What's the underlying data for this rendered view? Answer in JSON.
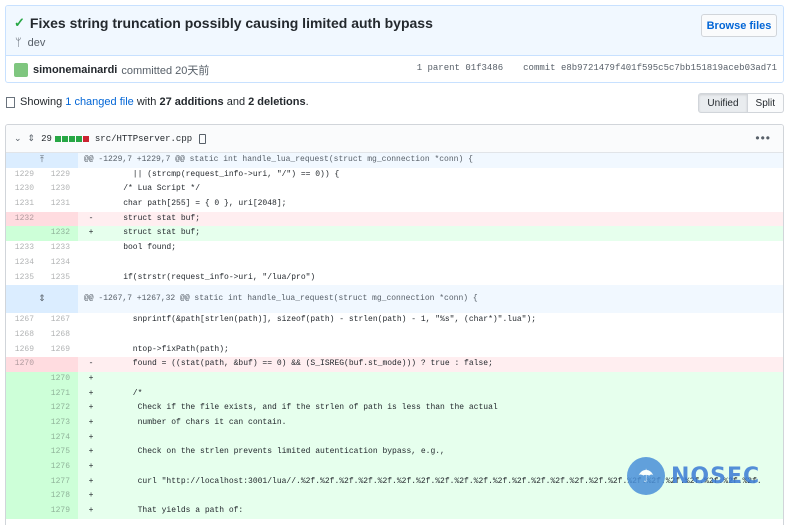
{
  "commit": {
    "title": "Fixes string truncation possibly causing limited auth bypass",
    "branch": "dev",
    "browse_label": "Browse files",
    "author": "simonemainardi",
    "committed_text": "committed 20天前",
    "parent_label": "1 parent",
    "parent_hash": "01f3486",
    "commit_label": "commit",
    "commit_hash": "e8b9721479f401f595c5c7bb151819aceb03ad71"
  },
  "summary": {
    "prefix": "Showing",
    "changed_files": "1 changed file",
    "with": "with",
    "additions": "27 additions",
    "and": "and",
    "deletions": "2 deletions",
    "suffix": "."
  },
  "view": {
    "unified": "Unified",
    "split": "Split"
  },
  "file": {
    "change_count": "29",
    "path": "src/HTTPserver.cpp",
    "more": "•••"
  },
  "diff": {
    "hunk1": "@@ -1229,7 +1229,7 @@ static int handle_lua_request(struct mg_connection *conn) {",
    "hunk2": "@@ -1267,7 +1267,32 @@ static int handle_lua_request(struct mg_connection *conn) {",
    "lines": [
      {
        "type": "ctx",
        "old": "1229",
        "new": "1229",
        "sign": "",
        "code": "      || (strcmp(request_info->uri, \"/\") == 0)) {"
      },
      {
        "type": "ctx",
        "old": "1230",
        "new": "1230",
        "sign": "",
        "code": "    /* Lua Script */"
      },
      {
        "type": "ctx",
        "old": "1231",
        "new": "1231",
        "sign": "",
        "code": "    char path[255] = { 0 }, uri[2048];"
      },
      {
        "type": "del",
        "old": "1232",
        "new": "",
        "sign": "-",
        "code": "    struct stat buf;"
      },
      {
        "type": "add",
        "old": "",
        "new": "1232",
        "sign": "+",
        "code": "    struct stat buf;"
      },
      {
        "type": "ctx",
        "old": "1233",
        "new": "1233",
        "sign": "",
        "code": "    bool found;"
      },
      {
        "type": "ctx",
        "old": "1234",
        "new": "1234",
        "sign": "",
        "code": ""
      },
      {
        "type": "ctx",
        "old": "1235",
        "new": "1235",
        "sign": "",
        "code": "    if(strstr(request_info->uri, \"/lua/pro\")"
      },
      {
        "type": "ctx",
        "old": "1267",
        "new": "1267",
        "sign": "",
        "code": "      snprintf(&path[strlen(path)], sizeof(path) - strlen(path) - 1, \"%s\", (char*)\".lua\");"
      },
      {
        "type": "ctx",
        "old": "1268",
        "new": "1268",
        "sign": "",
        "code": ""
      },
      {
        "type": "ctx",
        "old": "1269",
        "new": "1269",
        "sign": "",
        "code": "      ntop->fixPath(path);"
      },
      {
        "type": "del",
        "old": "1270",
        "new": "",
        "sign": "-",
        "code": "      found = ((stat(path, &buf) == 0) && (S_ISREG(buf.st_mode))) ? true : false;"
      },
      {
        "type": "add",
        "old": "",
        "new": "1270",
        "sign": "+",
        "code": ""
      },
      {
        "type": "add",
        "old": "",
        "new": "1271",
        "sign": "+",
        "code": "      /*"
      },
      {
        "type": "add",
        "old": "",
        "new": "1272",
        "sign": "+",
        "code": "       Check if the file exists, and if the strlen of path is less than the actual"
      },
      {
        "type": "add",
        "old": "",
        "new": "1273",
        "sign": "+",
        "code": "       number of chars it can contain."
      },
      {
        "type": "add",
        "old": "",
        "new": "1274",
        "sign": "+",
        "code": ""
      },
      {
        "type": "add",
        "old": "",
        "new": "1275",
        "sign": "+",
        "code": "       Check on the strlen prevents limited autentication bypass, e.g.,"
      },
      {
        "type": "add",
        "old": "",
        "new": "1276",
        "sign": "+",
        "code": ""
      },
      {
        "type": "add",
        "old": "",
        "new": "1277",
        "sign": "+",
        "code": "       curl \"http://localhost:3001/lua//.%2f.%2f.%2f.%2f.%2f.%2f.%2f.%2f.%2f.%2f.%2f.%2f.%2f.%2f.%2f.%2f.%2f.%2f.%2f.%2f.%2f.%2f.%2f.%2f."
      },
      {
        "type": "add",
        "old": "",
        "new": "1278",
        "sign": "+",
        "code": ""
      },
      {
        "type": "add",
        "old": "",
        "new": "1279",
        "sign": "+",
        "code": "       That yields a path of:"
      }
    ]
  },
  "watermark": {
    "text": "NOSEC"
  },
  "colors": {
    "add_bg": "#e6ffed",
    "del_bg": "#ffeef0",
    "hunk_bg": "#f1f8ff",
    "link": "#0366d6",
    "success": "#28a745"
  }
}
